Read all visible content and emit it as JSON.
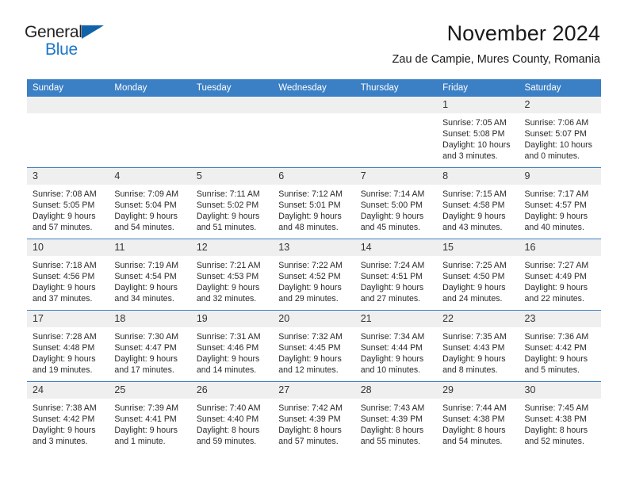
{
  "brand": {
    "name_part1": "General",
    "name_part2": "Blue",
    "accent_color": "#1b77c9",
    "triangle_color": "#1063a8",
    "triangle_icon": "triangle-icon"
  },
  "header": {
    "month_title": "November 2024",
    "location": "Zau de Campie, Mures County, Romania"
  },
  "calendar": {
    "header_bg": "#3b7fc4",
    "daynum_bg": "#efefef",
    "weekday_headers": [
      "Sunday",
      "Monday",
      "Tuesday",
      "Wednesday",
      "Thursday",
      "Friday",
      "Saturday"
    ],
    "weeks": [
      [
        {
          "day": "",
          "sunrise": "",
          "sunset": "",
          "daylight": "",
          "empty": true
        },
        {
          "day": "",
          "sunrise": "",
          "sunset": "",
          "daylight": "",
          "empty": true
        },
        {
          "day": "",
          "sunrise": "",
          "sunset": "",
          "daylight": "",
          "empty": true
        },
        {
          "day": "",
          "sunrise": "",
          "sunset": "",
          "daylight": "",
          "empty": true
        },
        {
          "day": "",
          "sunrise": "",
          "sunset": "",
          "daylight": "",
          "empty": true
        },
        {
          "day": "1",
          "sunrise": "Sunrise: 7:05 AM",
          "sunset": "Sunset: 5:08 PM",
          "daylight": "Daylight: 10 hours and 3 minutes."
        },
        {
          "day": "2",
          "sunrise": "Sunrise: 7:06 AM",
          "sunset": "Sunset: 5:07 PM",
          "daylight": "Daylight: 10 hours and 0 minutes."
        }
      ],
      [
        {
          "day": "3",
          "sunrise": "Sunrise: 7:08 AM",
          "sunset": "Sunset: 5:05 PM",
          "daylight": "Daylight: 9 hours and 57 minutes."
        },
        {
          "day": "4",
          "sunrise": "Sunrise: 7:09 AM",
          "sunset": "Sunset: 5:04 PM",
          "daylight": "Daylight: 9 hours and 54 minutes."
        },
        {
          "day": "5",
          "sunrise": "Sunrise: 7:11 AM",
          "sunset": "Sunset: 5:02 PM",
          "daylight": "Daylight: 9 hours and 51 minutes."
        },
        {
          "day": "6",
          "sunrise": "Sunrise: 7:12 AM",
          "sunset": "Sunset: 5:01 PM",
          "daylight": "Daylight: 9 hours and 48 minutes."
        },
        {
          "day": "7",
          "sunrise": "Sunrise: 7:14 AM",
          "sunset": "Sunset: 5:00 PM",
          "daylight": "Daylight: 9 hours and 45 minutes."
        },
        {
          "day": "8",
          "sunrise": "Sunrise: 7:15 AM",
          "sunset": "Sunset: 4:58 PM",
          "daylight": "Daylight: 9 hours and 43 minutes."
        },
        {
          "day": "9",
          "sunrise": "Sunrise: 7:17 AM",
          "sunset": "Sunset: 4:57 PM",
          "daylight": "Daylight: 9 hours and 40 minutes."
        }
      ],
      [
        {
          "day": "10",
          "sunrise": "Sunrise: 7:18 AM",
          "sunset": "Sunset: 4:56 PM",
          "daylight": "Daylight: 9 hours and 37 minutes."
        },
        {
          "day": "11",
          "sunrise": "Sunrise: 7:19 AM",
          "sunset": "Sunset: 4:54 PM",
          "daylight": "Daylight: 9 hours and 34 minutes."
        },
        {
          "day": "12",
          "sunrise": "Sunrise: 7:21 AM",
          "sunset": "Sunset: 4:53 PM",
          "daylight": "Daylight: 9 hours and 32 minutes."
        },
        {
          "day": "13",
          "sunrise": "Sunrise: 7:22 AM",
          "sunset": "Sunset: 4:52 PM",
          "daylight": "Daylight: 9 hours and 29 minutes."
        },
        {
          "day": "14",
          "sunrise": "Sunrise: 7:24 AM",
          "sunset": "Sunset: 4:51 PM",
          "daylight": "Daylight: 9 hours and 27 minutes."
        },
        {
          "day": "15",
          "sunrise": "Sunrise: 7:25 AM",
          "sunset": "Sunset: 4:50 PM",
          "daylight": "Daylight: 9 hours and 24 minutes."
        },
        {
          "day": "16",
          "sunrise": "Sunrise: 7:27 AM",
          "sunset": "Sunset: 4:49 PM",
          "daylight": "Daylight: 9 hours and 22 minutes."
        }
      ],
      [
        {
          "day": "17",
          "sunrise": "Sunrise: 7:28 AM",
          "sunset": "Sunset: 4:48 PM",
          "daylight": "Daylight: 9 hours and 19 minutes."
        },
        {
          "day": "18",
          "sunrise": "Sunrise: 7:30 AM",
          "sunset": "Sunset: 4:47 PM",
          "daylight": "Daylight: 9 hours and 17 minutes."
        },
        {
          "day": "19",
          "sunrise": "Sunrise: 7:31 AM",
          "sunset": "Sunset: 4:46 PM",
          "daylight": "Daylight: 9 hours and 14 minutes."
        },
        {
          "day": "20",
          "sunrise": "Sunrise: 7:32 AM",
          "sunset": "Sunset: 4:45 PM",
          "daylight": "Daylight: 9 hours and 12 minutes."
        },
        {
          "day": "21",
          "sunrise": "Sunrise: 7:34 AM",
          "sunset": "Sunset: 4:44 PM",
          "daylight": "Daylight: 9 hours and 10 minutes."
        },
        {
          "day": "22",
          "sunrise": "Sunrise: 7:35 AM",
          "sunset": "Sunset: 4:43 PM",
          "daylight": "Daylight: 9 hours and 8 minutes."
        },
        {
          "day": "23",
          "sunrise": "Sunrise: 7:36 AM",
          "sunset": "Sunset: 4:42 PM",
          "daylight": "Daylight: 9 hours and 5 minutes."
        }
      ],
      [
        {
          "day": "24",
          "sunrise": "Sunrise: 7:38 AM",
          "sunset": "Sunset: 4:42 PM",
          "daylight": "Daylight: 9 hours and 3 minutes."
        },
        {
          "day": "25",
          "sunrise": "Sunrise: 7:39 AM",
          "sunset": "Sunset: 4:41 PM",
          "daylight": "Daylight: 9 hours and 1 minute."
        },
        {
          "day": "26",
          "sunrise": "Sunrise: 7:40 AM",
          "sunset": "Sunset: 4:40 PM",
          "daylight": "Daylight: 8 hours and 59 minutes."
        },
        {
          "day": "27",
          "sunrise": "Sunrise: 7:42 AM",
          "sunset": "Sunset: 4:39 PM",
          "daylight": "Daylight: 8 hours and 57 minutes."
        },
        {
          "day": "28",
          "sunrise": "Sunrise: 7:43 AM",
          "sunset": "Sunset: 4:39 PM",
          "daylight": "Daylight: 8 hours and 55 minutes."
        },
        {
          "day": "29",
          "sunrise": "Sunrise: 7:44 AM",
          "sunset": "Sunset: 4:38 PM",
          "daylight": "Daylight: 8 hours and 54 minutes."
        },
        {
          "day": "30",
          "sunrise": "Sunrise: 7:45 AM",
          "sunset": "Sunset: 4:38 PM",
          "daylight": "Daylight: 8 hours and 52 minutes."
        }
      ]
    ]
  }
}
